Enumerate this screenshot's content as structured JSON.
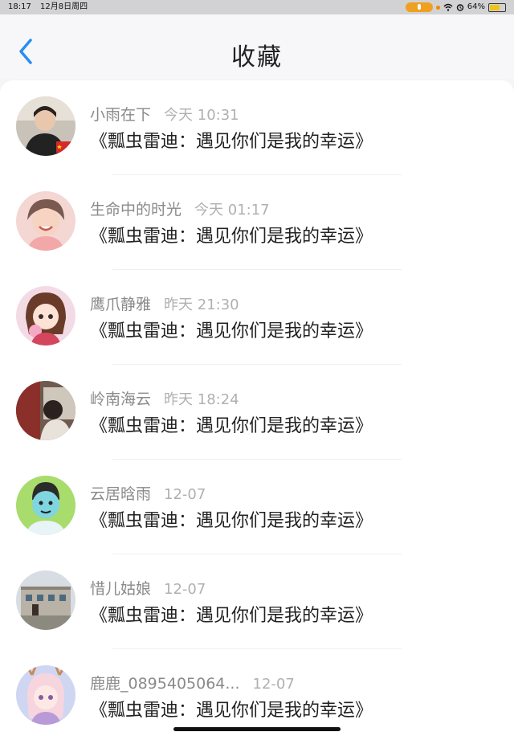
{
  "status": {
    "time": "18:17",
    "date": "12月8日周四",
    "battery": "64%"
  },
  "header": {
    "title": "收藏"
  },
  "items": [
    {
      "name": "小雨在下",
      "time": "今天 10:31",
      "content": "《瓢虫雷迪：遇见你们是我的幸运》"
    },
    {
      "name": "生命中的时光",
      "time": "今天 01:17",
      "content": "《瓢虫雷迪：遇见你们是我的幸运》"
    },
    {
      "name": "鹰爪静雅",
      "time": "昨天 21:30",
      "content": "《瓢虫雷迪：遇见你们是我的幸运》"
    },
    {
      "name": "岭南海云",
      "time": "昨天 18:24",
      "content": "《瓢虫雷迪：遇见你们是我的幸运》"
    },
    {
      "name": "云居晗雨",
      "time": "12-07",
      "content": "《瓢虫雷迪：遇见你们是我的幸运》"
    },
    {
      "name": "惜儿姑娘",
      "time": "12-07",
      "content": "《瓢虫雷迪：遇见你们是我的幸运》"
    },
    {
      "name": "鹿鹿_0895405064...",
      "time": "12-07",
      "content": "《瓢虫雷迪：遇见你们是我的幸运》"
    }
  ]
}
